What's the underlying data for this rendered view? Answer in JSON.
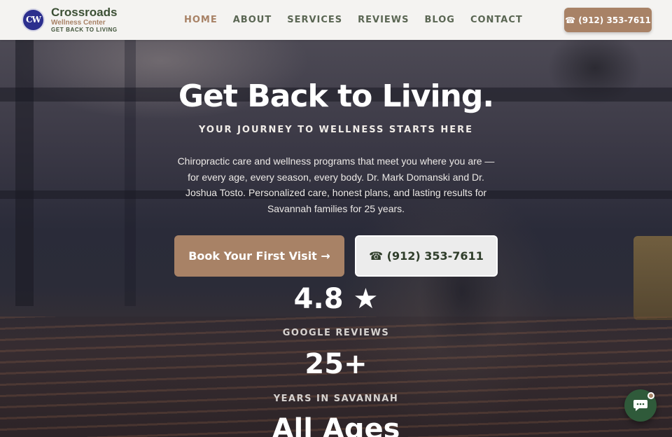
{
  "brand": {
    "name": "Crossroads",
    "subtitle": "Wellness Center",
    "tagline": "GET BACK TO LIVING",
    "mark": "CW"
  },
  "nav": {
    "items": [
      {
        "label": "HOME",
        "active": true
      },
      {
        "label": "ABOUT",
        "active": false
      },
      {
        "label": "SERVICES",
        "active": false
      },
      {
        "label": "REVIEWS",
        "active": false
      },
      {
        "label": "BLOG",
        "active": false
      },
      {
        "label": "CONTACT",
        "active": false
      }
    ],
    "phone_button": "☎ (912) 353-7611"
  },
  "hero": {
    "title": "Get Back to Living.",
    "subtitle": "YOUR JOURNEY TO WELLNESS STARTS HERE",
    "description": "Chiropractic care and wellness programs that meet you where you are — for every age, every season, every body. Dr. Mark Domanski and Dr. Joshua Tosto. Personalized care, honest plans, and lasting results for Savannah families for 25 years.",
    "primary_cta": "Book Your First Visit →",
    "secondary_cta": "☎ (912) 353-7611"
  },
  "stats": [
    {
      "value": "4.8",
      "label": "GOOGLE REVIEWS",
      "icon": "star-icon"
    },
    {
      "value": "25+",
      "label": "YEARS IN SAVANNAH"
    },
    {
      "value": "All Ages",
      "label": ""
    }
  ],
  "colors": {
    "accent": "#a88266",
    "brand_green": "#3b4f34",
    "chat_button": "#2f5a3a"
  },
  "chat": {
    "icon": "chat-bubble-icon"
  }
}
